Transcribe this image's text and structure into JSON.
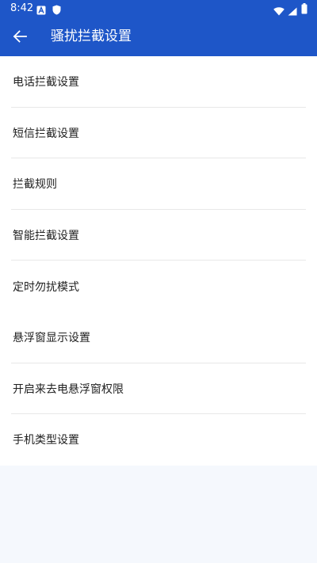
{
  "status_bar": {
    "time": "8:42",
    "icons": [
      "notification-a-icon",
      "shield-icon",
      "wifi-icon",
      "signal-icon",
      "battery-icon"
    ]
  },
  "app_bar": {
    "title": "骚扰拦截设置",
    "back_icon": "arrow-left-icon",
    "background": "#1e56c8"
  },
  "menu": {
    "items": [
      {
        "label": "电话拦截设置",
        "divider": true
      },
      {
        "label": "短信拦截设置",
        "divider": true
      },
      {
        "label": "拦截规则",
        "divider": true
      },
      {
        "label": "智能拦截设置",
        "divider": true
      },
      {
        "label": "定时勿扰模式",
        "divider": false
      },
      {
        "label": "悬浮窗显示设置",
        "divider": true
      },
      {
        "label": "开启来去电悬浮窗权限",
        "divider": true
      },
      {
        "label": "手机类型设置",
        "divider": false
      }
    ]
  },
  "colors": {
    "page_background": "#f5f8fd",
    "divider": "#e8e8e8",
    "text": "#222222"
  }
}
